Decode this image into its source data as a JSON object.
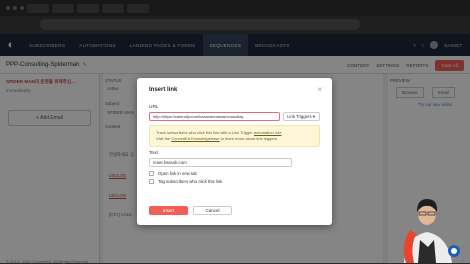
{
  "nav": {
    "items": [
      "SUBSCRIBERS",
      "AUTOMATIONS",
      "LANDING PAGES & FORMS",
      "SEQUENCES",
      "BROADCASTS"
    ],
    "active_index": 3,
    "user": "BASSET"
  },
  "header": {
    "title": "PPP-Consulting-Spiderman",
    "content": "CONTENT",
    "settings": "SETTINGS",
    "reports": "REPORTS",
    "save": "Save All"
  },
  "left": {
    "email_subject": "SPIDER MAN의 운영을 위해주신...",
    "email_when": "Immediately",
    "add": "+ Add Email"
  },
  "center": {
    "status_label": "STATUS",
    "status_value": "Active",
    "subject_label": "Subject",
    "subject_value": "SPIDER MAN",
    "content_label": "Content",
    "body1": "안녕하세요 공",
    "body2": "LBOLOE",
    "body3": "LBOLOE",
    "body4": "[CTA] CALE"
  },
  "right": {
    "preview": "PREVIEW",
    "browser": "Browser",
    "email": "Email",
    "try": "Try our new editor"
  },
  "footer": "© 2013 - 2022 ConvertKit. All Rights Reserved.",
  "modal": {
    "title": "Insert link",
    "url_label": "URL",
    "url_value": "http://https://calendly.com/hasandonanas/consultay",
    "link_triggers": "Link Triggers ▾",
    "info_line1": "Track subscribers who click this link with a Link Trigger",
    "info_link1": "automation rule",
    "info_line2": "Visit the",
    "info_link2": "ConvertKit Knowledgebase",
    "info_line3": "to learn more about link triggers.",
    "text_label": "Text",
    "text_value": "reset.hassok.com",
    "open_new_tab": "Open link in new tab",
    "tag_subscribers": "Tag subscribers who click this link",
    "insert": "Insert",
    "cancel": "Cancel"
  }
}
